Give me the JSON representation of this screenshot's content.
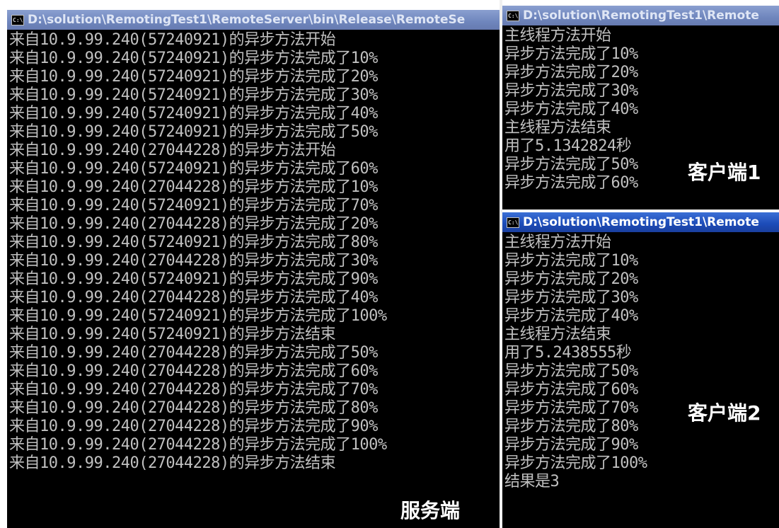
{
  "server": {
    "title": "D:\\solution\\RemotingTest1\\RemoteServer\\bin\\Release\\RemoteSe",
    "caption": "服务端",
    "lines": [
      "来自10.9.99.240(57240921)的异步方法开始",
      "来自10.9.99.240(57240921)的异步方法完成了10%",
      "来自10.9.99.240(57240921)的异步方法完成了20%",
      "来自10.9.99.240(57240921)的异步方法完成了30%",
      "来自10.9.99.240(57240921)的异步方法完成了40%",
      "来自10.9.99.240(57240921)的异步方法完成了50%",
      "来自10.9.99.240(27044228)的异步方法开始",
      "来自10.9.99.240(57240921)的异步方法完成了60%",
      "来自10.9.99.240(27044228)的异步方法完成了10%",
      "来自10.9.99.240(57240921)的异步方法完成了70%",
      "来自10.9.99.240(27044228)的异步方法完成了20%",
      "来自10.9.99.240(57240921)的异步方法完成了80%",
      "来自10.9.99.240(27044228)的异步方法完成了30%",
      "来自10.9.99.240(57240921)的异步方法完成了90%",
      "来自10.9.99.240(27044228)的异步方法完成了40%",
      "来自10.9.99.240(57240921)的异步方法完成了100%",
      "来自10.9.99.240(57240921)的异步方法结束",
      "来自10.9.99.240(27044228)的异步方法完成了50%",
      "来自10.9.99.240(27044228)的异步方法完成了60%",
      "来自10.9.99.240(27044228)的异步方法完成了70%",
      "来自10.9.99.240(27044228)的异步方法完成了80%",
      "来自10.9.99.240(27044228)的异步方法完成了90%",
      "来自10.9.99.240(27044228)的异步方法完成了100%",
      "来自10.9.99.240(27044228)的异步方法结束"
    ]
  },
  "client1": {
    "title": "D:\\solution\\RemotingTest1\\Remote",
    "caption": "客户端1",
    "lines": [
      "主线程方法开始",
      "异步方法完成了10%",
      "异步方法完成了20%",
      "异步方法完成了30%",
      "异步方法完成了40%",
      "主线程方法结束",
      "用了5.1342824秒",
      "异步方法完成了50%",
      "异步方法完成了60%"
    ]
  },
  "client2": {
    "title": "D:\\solution\\RemotingTest1\\Remote",
    "caption": "客户端2",
    "lines": [
      "主线程方法开始",
      "异步方法完成了10%",
      "异步方法完成了20%",
      "异步方法完成了30%",
      "异步方法完成了40%",
      "主线程方法结束",
      "用了5.2438555秒",
      "异步方法完成了50%",
      "异步方法完成了60%",
      "异步方法完成了70%",
      "异步方法完成了80%",
      "异步方法完成了90%",
      "异步方法完成了100%",
      "结果是3"
    ]
  },
  "icons": {
    "window_icon": "cmd-window-icon",
    "window_icon_glyph": "C:\\"
  },
  "colors": {
    "console_background": "#000000",
    "console_text": "#c0c0c0",
    "titlebar_active": "#1c4bb7",
    "titlebar_inactive": "#6f86bd",
    "caption_text": "#ffffff"
  }
}
